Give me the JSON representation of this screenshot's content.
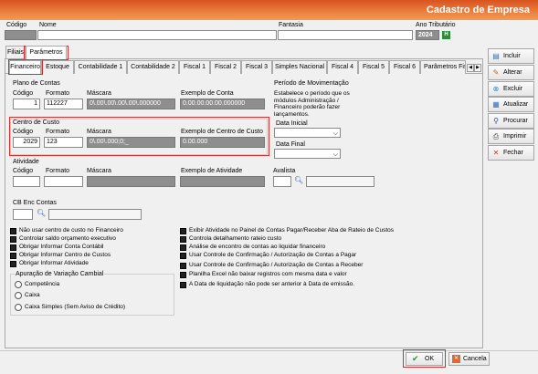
{
  "header": {
    "title": "Cadastro de Empresa"
  },
  "top_fields": {
    "codigo_label": "Código",
    "nome_label": "Nome",
    "fantasia_label": "Fantasia",
    "ano_label": "Ano Tributário",
    "ano_value": "2024",
    "ano_button": "H"
  },
  "outer_tabs": [
    {
      "label": "Filiais"
    },
    {
      "label": "Parâmetros"
    }
  ],
  "inner_tabs": [
    {
      "label": "Financeiro"
    },
    {
      "label": "Estoque"
    },
    {
      "label": "Contabilidade 1"
    },
    {
      "label": "Contabilidade 2"
    },
    {
      "label": "Fiscal 1"
    },
    {
      "label": "Fiscal 2"
    },
    {
      "label": "Fiscal 3"
    },
    {
      "label": "Simples Nacional"
    },
    {
      "label": "Fiscal 4"
    },
    {
      "label": "Fiscal 5"
    },
    {
      "label": "Fiscal 6"
    },
    {
      "label": "Parâmetros Fis"
    }
  ],
  "plano": {
    "title": "Plano de Contas",
    "codigo_label": "Código",
    "formato_label": "Formato",
    "mascara_label": "Máscara",
    "exemplo_label": "Exemplo de Conta",
    "codigo": "1",
    "formato": "112227",
    "mascara": "0\\.00\\.00\\.00\\.00\\.000000",
    "exemplo": "0.00.00.00.00.000000"
  },
  "centro": {
    "title": "Centro de Custo",
    "codigo_label": "Código",
    "formato_label": "Formato",
    "mascara_label": "Máscara",
    "exemplo_label": "Exemplo de Centro de Custo",
    "codigo": "2029",
    "formato": "123",
    "mascara": "0\\.00\\.000;0;_",
    "exemplo": "0.00.000"
  },
  "periodo": {
    "title": "Período de Movimentação",
    "desc": "Estabelece o período que os módulos Administração / Financeiro poderão fazer lançamentos.",
    "data_inicial": "Data Inicial",
    "data_final": "Data Final"
  },
  "atividade": {
    "title": "Atividade",
    "codigo_label": "Código",
    "formato_label": "Formato",
    "mascara_label": "Máscara",
    "exemplo_label": "Exemplo de Atividade",
    "avalista_label": "Avalista"
  },
  "cb_enc": {
    "label": "CB Enc Contas"
  },
  "checks_left": [
    {
      "label": "Não usar centro de custo no Financeiro",
      "checked": true
    },
    {
      "label": "Controlar saldo orçamento executivo",
      "checked": true
    },
    {
      "label": "Obrigar Informar Conta Contábil",
      "checked": true
    },
    {
      "label": "Obrigar Informar Centro de Custos",
      "checked": true
    },
    {
      "label": "Obrigar Informar Atividade",
      "checked": true
    }
  ],
  "apuracao": {
    "title": "Apuração de Variação Cambial",
    "options": [
      {
        "label": "Competência"
      },
      {
        "label": "Caixa"
      },
      {
        "label": "Caixa Simples (Sem Aviso de Crédito)"
      }
    ]
  },
  "checks_right": [
    {
      "label": "Exibir Atividade no Painel de Contas Pagar/Receber Aba de Rateio de Custos",
      "checked": true
    },
    {
      "label": "Controla detalhamento rateio custo",
      "checked": true
    },
    {
      "label": "Análise de encontro de contas ao liquidar financeiro",
      "checked": true
    },
    {
      "label": "Usar Controle de Confirmação / Autorização de Contas a Pagar",
      "checked": true
    },
    {
      "label": "Usar Controle de Confirmação / Autorização de Contas a Receber",
      "checked": true
    },
    {
      "label": "Planilha Excel não baixar registros com mesma data e valor",
      "checked": true
    },
    {
      "label": "A Data de liquidação não pode ser anterior à Data de emissão.",
      "checked": true
    }
  ],
  "side_buttons": [
    {
      "label": "Incluir",
      "icon": "document-icon"
    },
    {
      "label": "Alterar",
      "icon": "edit-icon"
    },
    {
      "label": "Excluir",
      "icon": "delete-icon"
    },
    {
      "label": "Atualizar",
      "icon": "refresh-icon"
    },
    {
      "label": "Procurar",
      "icon": "binoculars-icon"
    },
    {
      "label": "Imprimir",
      "icon": "printer-icon"
    },
    {
      "label": "Fechar",
      "icon": "close-icon"
    }
  ],
  "footer": {
    "ok": "OK",
    "cancel": "Cancela"
  },
  "colors": {
    "header_start": "#d9531f",
    "header_end": "#f29a55",
    "highlight": "#d32f2f"
  }
}
